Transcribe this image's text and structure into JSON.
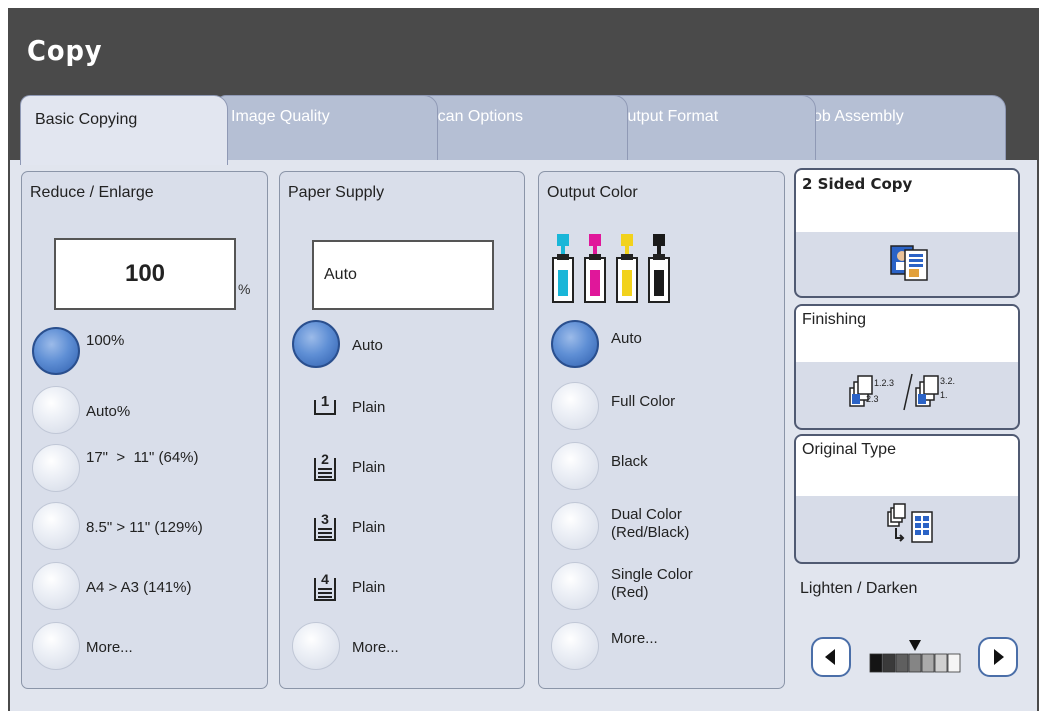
{
  "app": {
    "title": "Copy"
  },
  "tabs": [
    {
      "label": "Basic Copying",
      "selected": true
    },
    {
      "label": "Image Quality",
      "selected": false
    },
    {
      "label": "Scan Options",
      "selected": false
    },
    {
      "label": "Output Format",
      "selected": false
    },
    {
      "label": "Job Assembly",
      "selected": false
    }
  ],
  "reduce_enlarge": {
    "title": "Reduce / Enlarge",
    "value": "100",
    "unit": "%",
    "options": [
      {
        "label": "100%",
        "selected": true
      },
      {
        "label": "Auto%",
        "selected": false
      },
      {
        "label": "17\"  >  11\" (64%)",
        "selected": false
      },
      {
        "label": "8.5\" > 11\" (129%)",
        "selected": false
      },
      {
        "label": "A4 > A3 (141%)",
        "selected": false
      },
      {
        "label": "More...",
        "selected": false
      }
    ]
  },
  "paper_supply": {
    "title": "Paper Supply",
    "value": "Auto",
    "options": [
      {
        "label": "Auto",
        "selected": true,
        "tray": ""
      },
      {
        "label": "Plain",
        "selected": false,
        "tray": "1"
      },
      {
        "label": "Plain",
        "selected": false,
        "tray": "2"
      },
      {
        "label": "Plain",
        "selected": false,
        "tray": "3"
      },
      {
        "label": "Plain",
        "selected": false,
        "tray": "4"
      },
      {
        "label": "More...",
        "selected": false,
        "tray": ""
      }
    ]
  },
  "output_color": {
    "title": "Output Color",
    "toner_colors": [
      "#19b6d8",
      "#e0179a",
      "#f2d21c",
      "#1a1a1a"
    ],
    "options": [
      {
        "label": "Auto",
        "selected": true
      },
      {
        "label": "Full Color",
        "selected": false
      },
      {
        "label": "Black",
        "selected": false
      },
      {
        "label": "Dual Color\n(Red/Black)",
        "selected": false
      },
      {
        "label": "Single Color\n(Red)",
        "selected": false
      },
      {
        "label": "More...",
        "selected": false
      }
    ]
  },
  "side_buttons": {
    "two_sided": "2 Sided Copy",
    "finishing": "Finishing",
    "finishing_icon_text": {
      "left": "1.2.3",
      "left_sub": "2.3",
      "right": "3.2.",
      "right_sub": "1."
    },
    "original_type": "Original Type"
  },
  "lighten_darken": {
    "label": "Lighten / Darken",
    "level_index": 3,
    "scale_size": 7
  },
  "colors": {
    "frame": "#4a4a4a",
    "tab_inactive": "#b5bfd4",
    "tab_active": "#e2e6f0",
    "panel": "#d9deea",
    "radio_on": "#2f5fae"
  }
}
